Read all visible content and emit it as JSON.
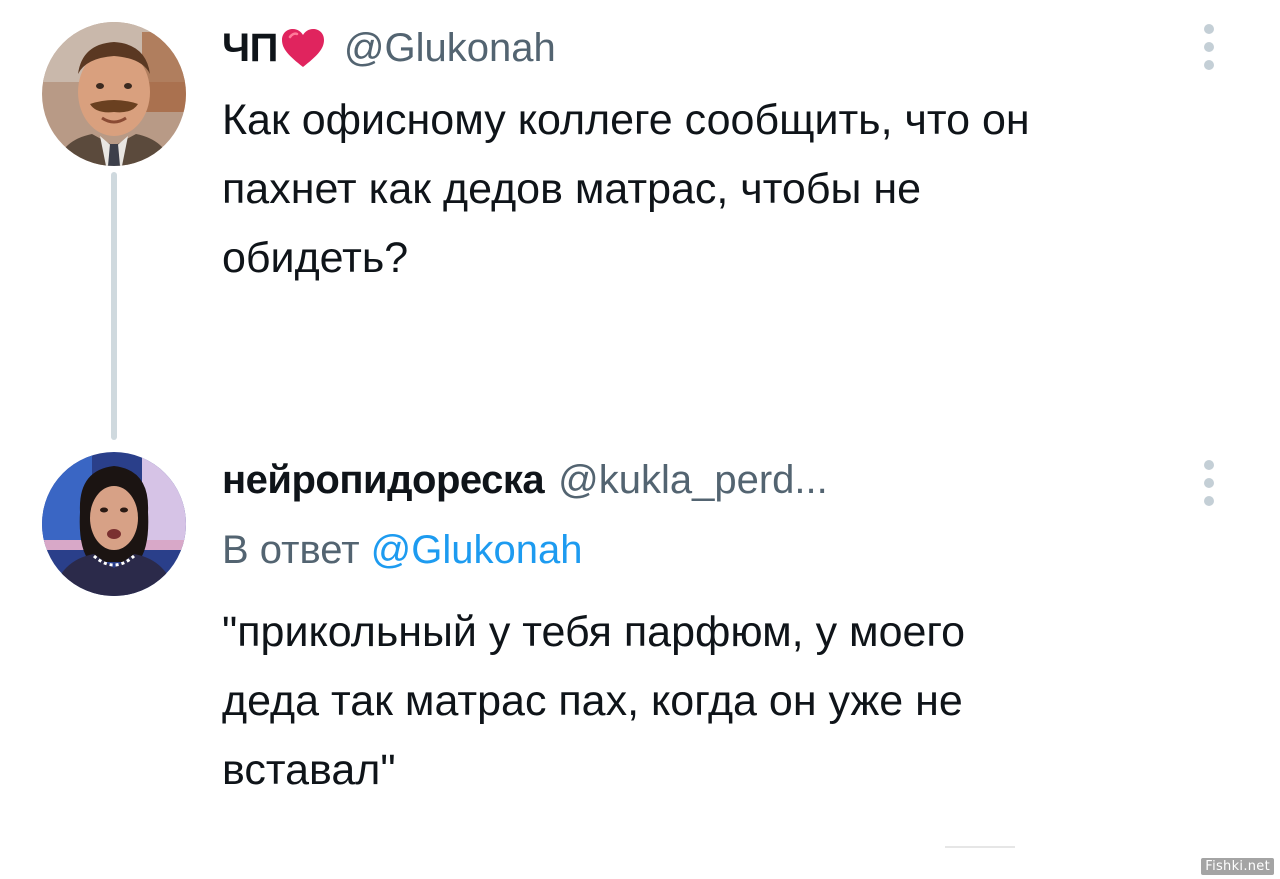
{
  "tweets": [
    {
      "display_name": "ЧП",
      "name_emoji": "heart-icon",
      "handle": "@Glukonah",
      "avatar": "avatar-mustached-man",
      "text": "Как офисному коллеге сообщить, что он\nпахнет как дедов матрас, чтобы не\nобидеть?",
      "more_icon": "more-vertical-icon"
    },
    {
      "display_name": "нейропидореска",
      "handle": "@kukla_perd...",
      "avatar": "avatar-woman-tv-studio",
      "reply_prefix": "В ответ",
      "reply_mention": "@Glukonah",
      "text": "\"прикольный у тебя парфюм, у моего\nдеда так матрас пах, когда он уже не\nвставал\"",
      "more_icon": "more-vertical-icon"
    }
  ],
  "colors": {
    "text_primary": "#0f1419",
    "text_secondary": "#536471",
    "link": "#1d9bf0",
    "thread_line": "#cfd9de",
    "heart": "#e0245e"
  },
  "watermark": "Fishki.net"
}
